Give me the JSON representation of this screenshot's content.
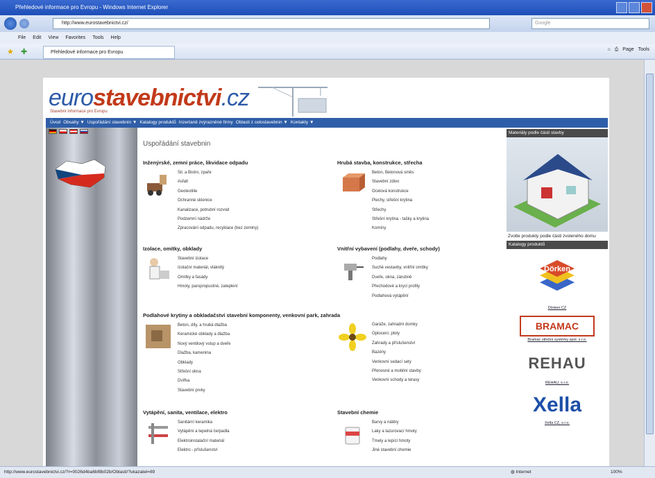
{
  "browser": {
    "title": "Přehledové informace pro Evropu - Windows Internet Explorer",
    "url": "http://www.eurostavebnictvi.cz/",
    "search_placeholder": "Google",
    "menu": [
      "File",
      "Edit",
      "View",
      "Favorites",
      "Tools",
      "Help"
    ],
    "tab": "Přehledové informace pro Evropu",
    "toolbar_right": [
      "Page",
      "Tools"
    ],
    "status": "http://www.eurostavebnictvi.cz/?r=0026d4ba6bf8b02b/Oblasti/?ukazatel=89",
    "zone": "Internet",
    "zoom": "100%"
  },
  "site": {
    "logo_plain": "euro",
    "logo_bold": "stavebnictvi",
    "logo_tld": ".cz",
    "tagline": "Stavební informace pro Evropu",
    "nav": [
      "Úvod",
      "Obsahy ▼",
      "Uspořádání stavebnin ▼",
      "Katalogy produktů",
      "Inzertaně zvýrazněné firmy",
      "Oblasti z celostavebnin ▼",
      "Kontakty ▼"
    ],
    "page_title": "Uspořádání stavebnin"
  },
  "sections": [
    {
      "title": "Inženýrské, zemní práce, likvidace odpadu",
      "items": [
        "Sil. a Bistro, zpaře",
        "Asfalt",
        "Geotextilie",
        "Ochranné sklenice",
        "Kanalizace, potrubní rozvod",
        "Podzemní nádrže",
        "Zpracování odpadu, recyklace (bez zeminy)"
      ]
    },
    {
      "title": "Hrubá stavba, konstrukce, střecha",
      "items": [
        "Beton, Betonová směs",
        "Stavební zdivo",
        "Ocelová konstrukce",
        "Plechy, střešní krytina",
        "Střechy",
        "Střešní krytina - tašky a krytina",
        "Komíny"
      ]
    },
    {
      "title": "Izolace, omítky, obklady",
      "items": [
        "Stavební izolace",
        "Izolační materiál, vláknitý",
        "Omítky a fasády",
        "Hmoty, paropropustné, zateplení"
      ]
    },
    {
      "title": "Vnitřní vybavení (podlahy, dveře, schody)",
      "items": [
        "Podlahy",
        "Suché vestavby, vnitřní omítky",
        "Dveře, okna, zárubně",
        "Přechodové a krycí profily",
        "Podlahová vytápění"
      ]
    },
    {
      "title": "Podlahové krytiny a obkladačství stavební komponenty, venkovní park, zahrada",
      "items": [
        "Beton, díly, a hrubá dlažba",
        "Keramické obklady a dlažba",
        "Nový ventilový vstup a dveře",
        "Dlažba, kamenina",
        "Obklady",
        "Střešní okna",
        "Dvířka",
        "Stavební prvky"
      ]
    },
    {
      "title": "",
      "items": [
        "Garáže, zahradní domky",
        "Oplocení, ploty",
        "Zahrady a příslušenství",
        "Bazény",
        "Venkovní sedací sety",
        "Přenosné a mobilní stavby",
        "Venkovní schody a terasy"
      ]
    },
    {
      "title": "Vytápění, sanita, ventilace, elektro",
      "items": [
        "Sanitární keramika",
        "Vytápění a tepelná čerpadla",
        "Elektroinstalační materiál",
        "Elektro - příslušenství"
      ]
    },
    {
      "title": "Stavební chemie",
      "items": [
        "Barvy a nátěry",
        "Laky a lazurovací hmoty",
        "Tmely a lepící hmoty",
        "Jiné stavební chemie"
      ]
    }
  ],
  "sidebar": {
    "head1": "Materiály podle části stavby",
    "house_text": "Zvolte produkty podle části zvoleného domu",
    "head2": "Katalogy produktů",
    "brands": [
      {
        "name": "Dörken",
        "caption": "Dörken CZ"
      },
      {
        "name": "BRAMAC",
        "caption": "Bramac střešní systémy spol. s r.o."
      },
      {
        "name": "REHAU",
        "caption": "REHAU, s.r.o."
      },
      {
        "name": "Xella",
        "caption": "Xella CZ, s.r.o."
      }
    ]
  }
}
